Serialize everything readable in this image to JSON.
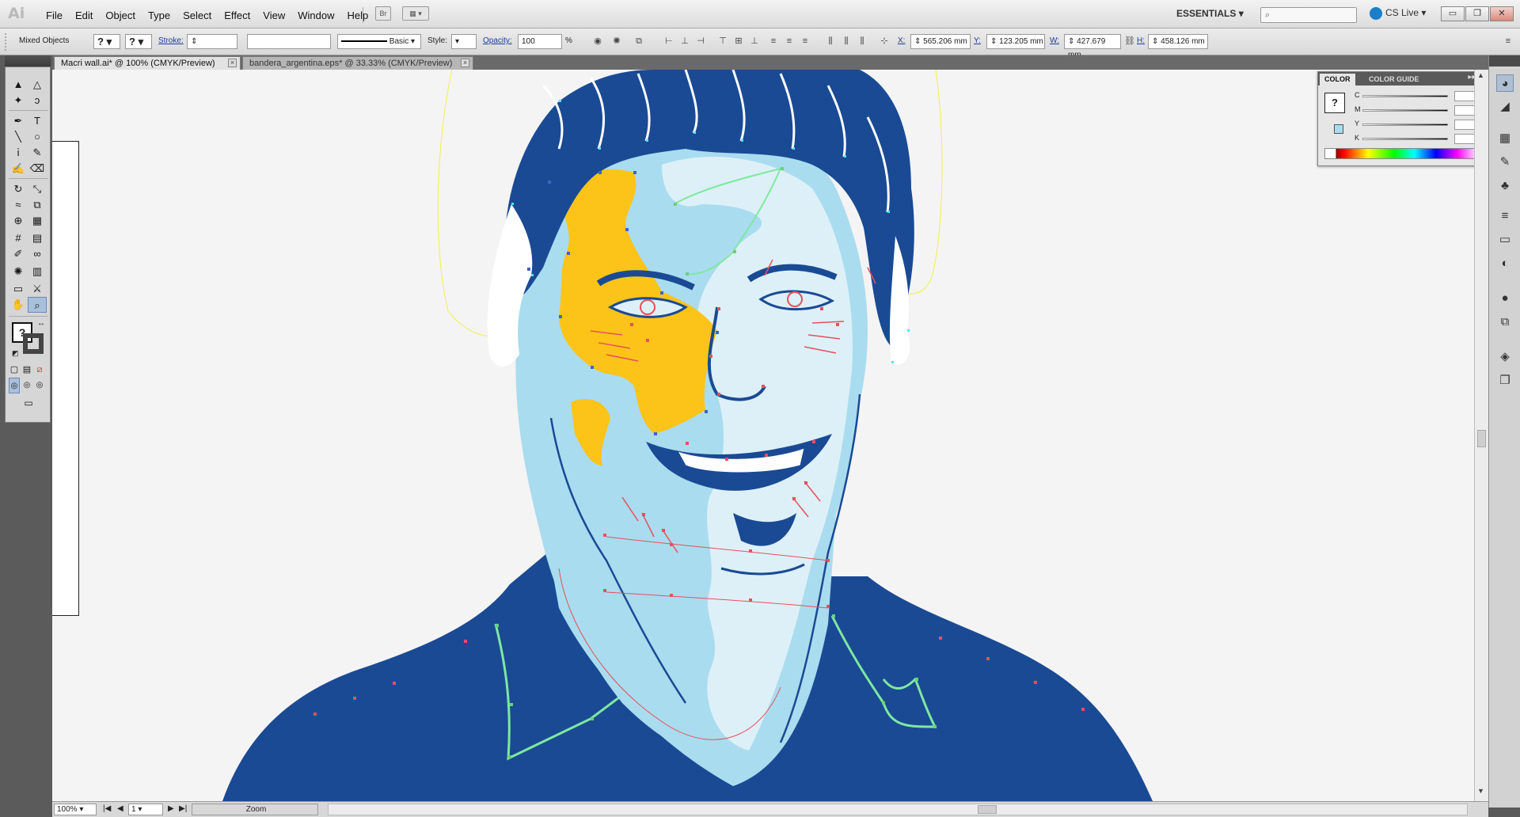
{
  "app": {
    "logo": "Ai"
  },
  "menu": [
    "File",
    "Edit",
    "Object",
    "Type",
    "Select",
    "Effect",
    "View",
    "Window",
    "Help"
  ],
  "menubar": {
    "br_label": "Br",
    "workspace": "ESSENTIALS",
    "search_placeholder": "",
    "cslive": "CS Live",
    "window_buttons": {
      "minimize": "▭",
      "restore": "❐",
      "close": "✕"
    }
  },
  "control": {
    "selection_type": "Mixed Objects",
    "fill_value": "?",
    "stroke_value": "?",
    "stroke_label": "Stroke:",
    "brush_label": "Basic",
    "style_label": "Style:",
    "opacity_label": "Opacity:",
    "opacity_value": "100",
    "opacity_unit": "%",
    "x_label": "X:",
    "x_value": "565.206 mm",
    "y_label": "Y:",
    "y_value": "123.205 mm",
    "w_label": "W:",
    "w_value": "427.679 mm",
    "h_label": "H:",
    "h_value": "458.126 mm"
  },
  "tabs": [
    {
      "label": "Macri wall.ai* @ 100% (CMYK/Preview)",
      "active": true
    },
    {
      "label": "bandera_argentina.eps* @ 33.33% (CMYK/Preview)",
      "active": false
    }
  ],
  "color_panel": {
    "tab_color": "COLOR",
    "tab_guide": "COLOR GUIDE",
    "menu_icon": "▸▸ ≡",
    "channels": [
      "C",
      "M",
      "Y",
      "K"
    ],
    "unit": "%"
  },
  "status": {
    "zoom": "100%",
    "page": "1",
    "tool_label": "Zoom"
  },
  "colors": {
    "navy": "#1a4a94",
    "light_blue": "#a9dcef",
    "pale_blue": "#ddf0f8",
    "yellow": "#fcc419",
    "anchor_red": "#e8505b",
    "anchor_blue": "#3d64c8",
    "anchor_green": "#6ad07a"
  },
  "icons": {
    "selection": "▲",
    "direct_selection": "△",
    "magic_wand": "✦",
    "lasso": "ↄ",
    "pen": "✒",
    "type": "T",
    "line": "╲",
    "ellipse": "○",
    "brush": "ⅰ",
    "pencil": "✎",
    "blob_brush": "✍",
    "eraser": "⌫",
    "rotate": "↻",
    "scale": "⤡",
    "warp": "≈",
    "free_transform": "⧉",
    "shape_builder": "⊕",
    "perspective": "▦",
    "mesh": "#",
    "gradient": "▤",
    "eyedropper": "✐",
    "blend": "∞",
    "symbol_sprayer": "✺",
    "graph": "▥",
    "artboard": "▭",
    "slice": "⚔",
    "hand": "✋",
    "zoom": "⌕"
  }
}
